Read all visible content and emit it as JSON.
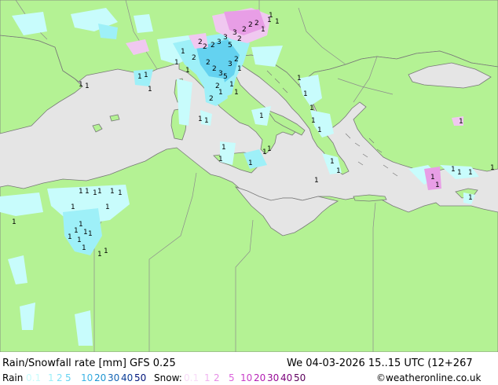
{
  "colors": {
    "sea": "#e5e5e5",
    "land": "#b4f294",
    "land_alt": "#c8f5a8",
    "border": "#8c8c8c",
    "coast": "#787878",
    "rain_light": "#c8fcfc",
    "rain_mid": "#9ef0f8",
    "rain_heavy": "#64d2f0",
    "snow_light": "#f0c8f0",
    "snow_mid": "#e89ee6"
  },
  "map": {
    "value_labels": [
      "1",
      "2",
      "3",
      "5"
    ]
  },
  "footer": {
    "title": "Rain/Snowfall rate [mm] GFS 0.25",
    "datetime": "We 04-03-2026 15..15 UTC (12+267",
    "rain_label": "Rain",
    "snow_label": "Snow:",
    "credit": "©weatheronline.co.uk",
    "rain_scale": [
      {
        "text": "0.1",
        "color": "#c8fcfc"
      },
      {
        "text": "1",
        "color": "#9ef0f8"
      },
      {
        "text": "2",
        "color": "#7ee0f8"
      },
      {
        "text": "5",
        "color": "#64d2f0"
      },
      {
        "text": "10",
        "color": "#3cb4e6"
      },
      {
        "text": "20",
        "color": "#1e96d2"
      },
      {
        "text": "30",
        "color": "#1464b4"
      },
      {
        "text": "40",
        "color": "#0a3c96"
      },
      {
        "text": "50",
        "color": "#00147a"
      }
    ],
    "snow_scale": [
      {
        "text": "0.1",
        "color": "#f8dcf8"
      },
      {
        "text": "1",
        "color": "#f0b4f0"
      },
      {
        "text": "2",
        "color": "#e68ce6"
      },
      {
        "text": "5",
        "color": "#dc64dc"
      },
      {
        "text": "10",
        "color": "#c83cc8"
      },
      {
        "text": "20",
        "color": "#b41eb4"
      },
      {
        "text": "30",
        "color": "#960a96"
      },
      {
        "text": "40",
        "color": "#7a007a"
      },
      {
        "text": "50",
        "color": "#5a005a"
      }
    ]
  }
}
